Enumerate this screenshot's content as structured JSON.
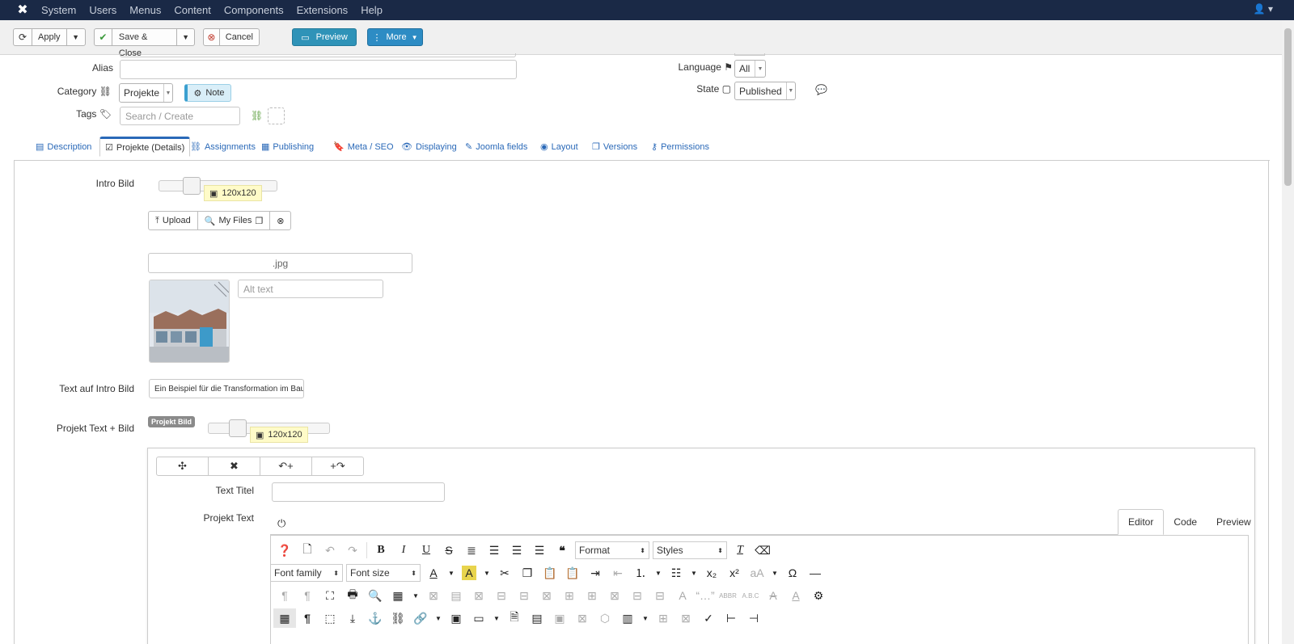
{
  "topnav": {
    "menu": [
      "System",
      "Users",
      "Menus",
      "Content",
      "Components",
      "Extensions",
      "Help"
    ]
  },
  "toolbar": {
    "apply": "Apply",
    "save_close": "Save & Close",
    "cancel": "Cancel",
    "preview": "Preview",
    "more": "More"
  },
  "form": {
    "alias_label": "Alias",
    "category_label": "Category",
    "category_value": "Projekte",
    "note_label": "Note",
    "tags_label": "Tags",
    "tags_placeholder": "Search / Create",
    "language_label": "Language",
    "language_value": "All",
    "state_label": "State",
    "state_value": "Published"
  },
  "tabs": [
    "Description",
    "Projekte (Details)",
    "Assignments",
    "Publishing",
    "Meta / SEO",
    "Displaying",
    "Joomla fields",
    "Layout",
    "Versions",
    "Permissions"
  ],
  "details": {
    "intro_bild_label": "Intro Bild",
    "size_tip": "120x120",
    "upload": "Upload",
    "my_files": "My Files",
    "file_name": ".jpg",
    "alt_placeholder": "Alt text",
    "text_intro_label": "Text auf Intro Bild",
    "text_intro_value": "Ein Beispiel für die Transformation im Bau",
    "projekt_text_bild_label": "Projekt Text + Bild",
    "projekt_bild_badge": "Projekt Bild",
    "size_tip2": "120x120",
    "text_titel_label": "Text Titel",
    "projekt_text_label": "Projekt Text"
  },
  "editor": {
    "tabs": [
      "Editor",
      "Code",
      "Preview"
    ],
    "format": "Format",
    "styles": "Styles",
    "font_family": "Font family",
    "font_size": "Font size"
  },
  "colors": {
    "topbar": "#1a2946",
    "link": "#2a69b8",
    "preview_button": "#2f93b8",
    "more_button": "#2d8cc4"
  }
}
